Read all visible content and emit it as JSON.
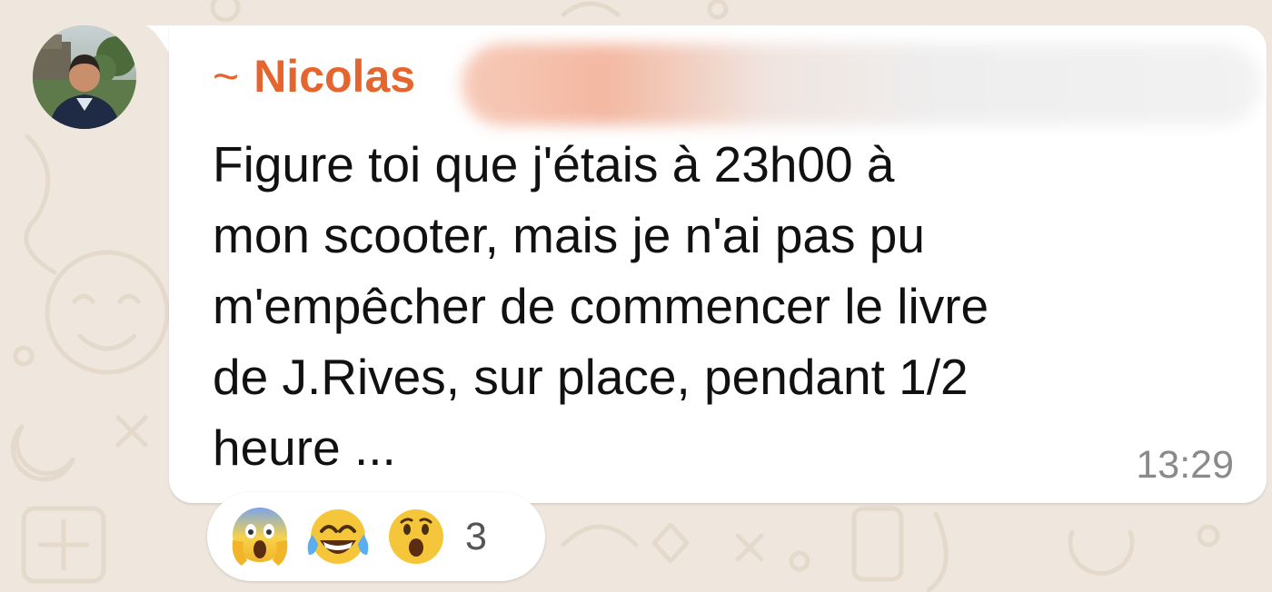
{
  "chat": {
    "sender_prefix": "~",
    "sender_name": "Nicolas",
    "message_text": "Figure toi que j'étais à 23h00 à\nmon scooter, mais je n'ai pas pu\nm'empêcher de commencer le livre\nde J.Rives, sur place, pendant 1/2\nheure ...",
    "timestamp": "13:29",
    "reactions": [
      "face-screaming-in-fear-icon",
      "face-with-tears-of-joy-icon",
      "face-with-open-mouth-icon"
    ],
    "reaction_count": "3"
  },
  "colors": {
    "sender": "#e5652f",
    "wallpaper": "#efe7dd",
    "bubble": "#ffffff"
  }
}
